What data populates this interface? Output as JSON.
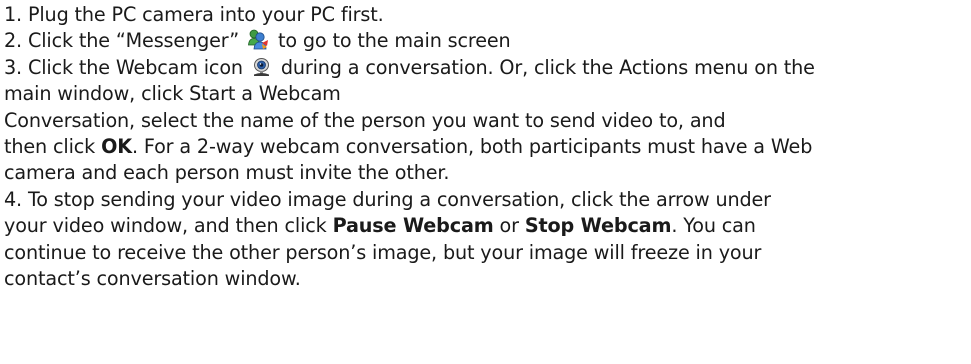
{
  "step1": {
    "text": "1. Plug the PC camera into your PC first."
  },
  "step2": {
    "before": "2. Click the “Messenger” ",
    "icon": "messenger-buddies-icon",
    "after": " to go to the main screen"
  },
  "step3": {
    "line1_before": "3. Click the Webcam icon ",
    "icon": "webcam-icon",
    "line1_after": " during a conversation. Or, click the Actions menu on the",
    "line2": "main window, click Start a Webcam",
    "line3": "Conversation, select the name of the person you want to send video to, and",
    "line4_before": "then click ",
    "line4_bold": "OK",
    "line4_after": ". For a 2-way webcam conversation, both participants must have a Web",
    "line5": "camera and each person must invite the other."
  },
  "step4": {
    "line1": "4. To stop sending your video image during a conversation, click the arrow under",
    "line2_before": "your video window, and then click ",
    "line2_bold1": "Pause Webcam",
    "line2_mid": " or ",
    "line2_bold2": "Stop Webcam",
    "line2_after": ". You can",
    "line3": "continue to receive the other person’s image, but your image will freeze in your",
    "line4": "contact’s conversation window."
  }
}
